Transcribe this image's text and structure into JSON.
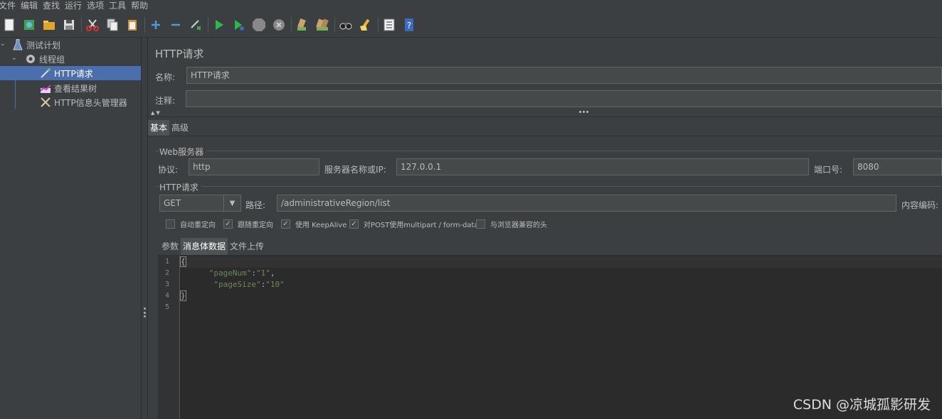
{
  "menu": [
    "文件",
    "编辑",
    "查找",
    "运行",
    "选项",
    "工具",
    "帮助"
  ],
  "toolbar_icons": [
    "new-icon",
    "templates-icon",
    "open-icon",
    "save-icon",
    "cut-icon",
    "copy-icon",
    "paste-icon",
    "expand-icon",
    "collapse-icon",
    "toggle-icon",
    "start-icon",
    "start-no-pause-icon",
    "stop-icon",
    "shutdown-icon",
    "clear-icon",
    "clear-all-icon",
    "search-icon",
    "reset-search-icon",
    "function-helper-icon",
    "help-icon"
  ],
  "tree": {
    "items": [
      {
        "label": "测试计划"
      },
      {
        "label": "线程组"
      },
      {
        "label": "HTTP请求"
      },
      {
        "label": "查看结果树"
      },
      {
        "label": "HTTP信息头管理器"
      }
    ]
  },
  "panel": {
    "title": "HTTP请求",
    "name_label": "名称:",
    "name_value": "HTTP请求",
    "comment_label": "注释:",
    "comment_value": "",
    "tabs": [
      "基本",
      "高级"
    ]
  },
  "web_server": {
    "group_title": "Web服务器",
    "protocol_label": "协议:",
    "protocol_value": "http",
    "server_label": "服务器名称或IP:",
    "server_value": "127.0.0.1",
    "port_label": "端口号:",
    "port_value": "8080"
  },
  "http_request": {
    "group_title": "HTTP请求",
    "method": "GET",
    "path_label": "路径:",
    "path_value": "/administrativeRegion/list",
    "encoding_label": "内容编码:",
    "checkboxes": [
      {
        "label": "自动重定向",
        "checked": false
      },
      {
        "label": "跟随重定向",
        "checked": true
      },
      {
        "label": "使用 KeepAlive",
        "checked": true
      },
      {
        "label": "对POST使用multipart / form-data",
        "checked": true
      },
      {
        "label": "与浏览器兼容的头",
        "checked": false
      }
    ]
  },
  "body_tabs": [
    "参数",
    "消息体数据",
    "文件上传"
  ],
  "editor": {
    "line_numbers": [
      "1",
      "2",
      "3",
      "4",
      "5"
    ],
    "line1": "{",
    "line2_indent": "      ",
    "line2_key": "\"pageNum\"",
    "line2_colon": ":",
    "line2_val": "\"1\"",
    "line2_comma": ",",
    "line3_indent": "       ",
    "line3_key": "\"pageSize\"",
    "line3_colon": ":",
    "line3_val": "\"10\"",
    "line4": "}"
  },
  "watermark": "CSDN @凉城孤影研发",
  "colors": {
    "background": "#3c3f41",
    "selection": "#4b6eaf",
    "editor_bg": "#2b2b2b",
    "string": "#6a8759"
  }
}
